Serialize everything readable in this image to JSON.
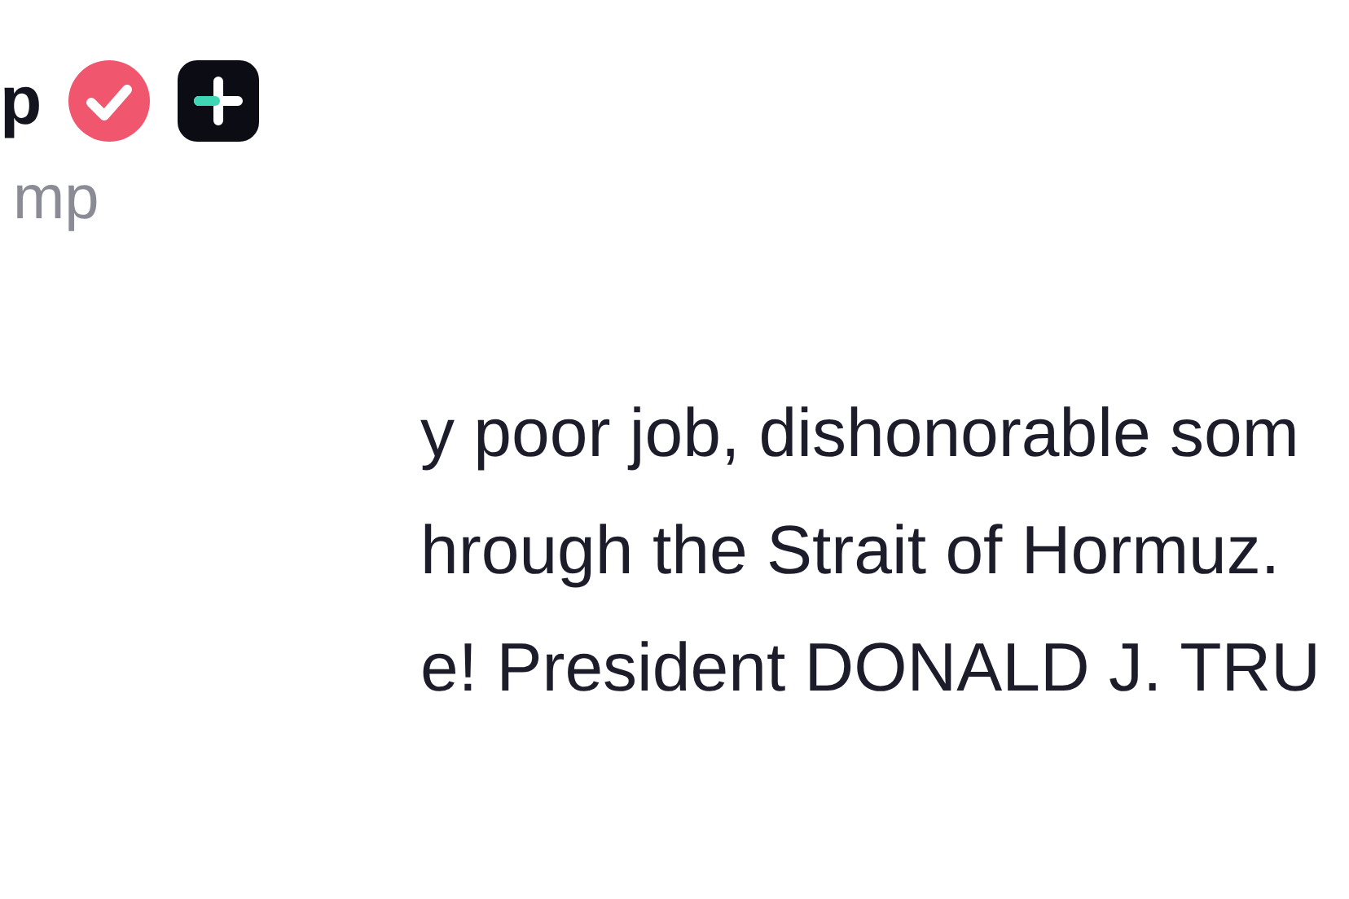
{
  "author": {
    "name": "p",
    "verified": true,
    "handle": "mp"
  },
  "post": {
    "lines": [
      "y poor job, dishonorable som",
      "hrough the Strait of Hormuz.",
      "e! President DONALD J. TRU"
    ]
  }
}
